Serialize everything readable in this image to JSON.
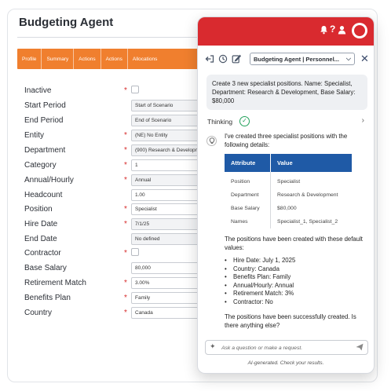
{
  "app": {
    "title": "Budgeting Agent",
    "tabs": [
      "Profile",
      "Summary",
      "Actions",
      "Actions",
      "Allocations"
    ]
  },
  "form": {
    "rows": [
      {
        "label": "Inactive",
        "required": true,
        "type": "checkbox",
        "value": ""
      },
      {
        "label": "Start Period",
        "required": false,
        "type": "select",
        "value": "Start of Scenario"
      },
      {
        "label": "End Period",
        "required": false,
        "type": "select",
        "value": "End of Scenario"
      },
      {
        "label": "Entity",
        "required": true,
        "type": "select",
        "value": "(NE) No Entity"
      },
      {
        "label": "Department",
        "required": true,
        "type": "select",
        "value": "(900) Research & Development"
      },
      {
        "label": "Category",
        "required": true,
        "type": "text",
        "value": "1"
      },
      {
        "label": "Annual/Hourly",
        "required": true,
        "type": "select",
        "value": "Annual"
      },
      {
        "label": "Headcount",
        "required": false,
        "type": "text",
        "value": "1.00"
      },
      {
        "label": "Position",
        "required": true,
        "type": "text",
        "value": "Specialist"
      },
      {
        "label": "Hire Date",
        "required": true,
        "type": "select",
        "value": "7/1/25"
      },
      {
        "label": "End Date",
        "required": false,
        "type": "select",
        "value": "No defined"
      },
      {
        "label": "Contractor",
        "required": true,
        "type": "checkbox",
        "value": ""
      },
      {
        "label": "Base Salary",
        "required": false,
        "type": "text",
        "value": "80,000"
      },
      {
        "label": "Retirement Match",
        "required": true,
        "type": "text",
        "value": "3.00%"
      },
      {
        "label": "Benefits Plan",
        "required": true,
        "type": "text",
        "value": "Family"
      },
      {
        "label": "Country",
        "required": true,
        "type": "text",
        "value": "Canada"
      }
    ]
  },
  "chat": {
    "header_icons": [
      "bell-icon",
      "help-icon",
      "user-icon"
    ],
    "brand_color": "#d92a2f",
    "agent_select": "Budgeting Agent | Personnel...",
    "user_message": "Create 3 new specialist positions. Name: Specialist, Department: Research & Development, Base Salary: $80,000",
    "thinking_label": "Thinking",
    "response_intro": "I've created three specialist positions with the following details:",
    "table": {
      "headers": [
        "Attribute",
        "Value"
      ],
      "rows": [
        [
          "Position",
          "Specialist"
        ],
        [
          "Department",
          "Research & Development"
        ],
        [
          "Base Salary",
          "$80,000"
        ],
        [
          "Names",
          "Specialist_1, Specialist_2"
        ]
      ]
    },
    "defaults_intro": "The positions have been created with these default values:",
    "defaults": [
      "Hire Date: July 1, 2025",
      "Country: Canada",
      "Benefits Plan: Family",
      "Annual/Hourly: Annual",
      "Retirement Match: 3%",
      "Contractor: No"
    ],
    "closing": "The positions have been successfully created. Is there anything else?",
    "input_placeholder": "Ask a question or make a request.",
    "footer": "AI-generated. Check your results."
  }
}
